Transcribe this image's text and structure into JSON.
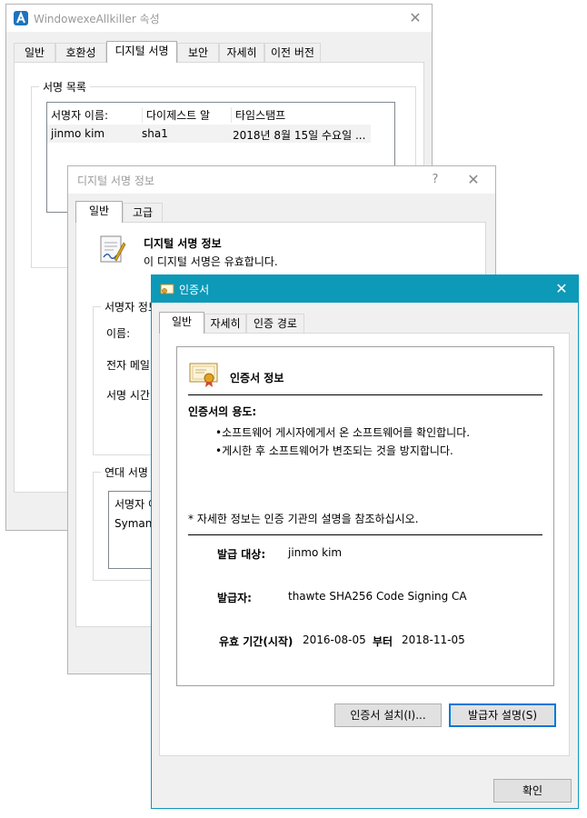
{
  "props_window": {
    "title": "WindowexeAllkiller 속성",
    "close": "✕",
    "tabs": [
      "일반",
      "호환성",
      "디지털 서명",
      "보안",
      "자세히",
      "이전 버전"
    ],
    "sig_list_group": "서명 목록",
    "columns": [
      "서명자 이름:",
      "다이제스트 알",
      "타임스탬프"
    ],
    "row": [
      "jinmo kim",
      "sha1",
      "2018년 8월 15일 수요일 ..."
    ]
  },
  "sig_details_window": {
    "title": "디지털 서명 정보",
    "help": "?",
    "close": "✕",
    "tabs": [
      "일반",
      "고급"
    ],
    "heading": "디지털 서명 정보",
    "status": "이 디지털 서명은 유효합니다.",
    "signer_group": "서명자 정보",
    "name_label": "이름:",
    "email_label": "전자 메일:",
    "time_label": "서명 시간:",
    "countersig_group": "연대 서명",
    "countersig_col": "서명자 이름:",
    "countersig_row": "Symantec"
  },
  "cert_window": {
    "title": "인증서",
    "close": "✕",
    "tabs": [
      "일반",
      "자세히",
      "인증 경로"
    ],
    "heading": "인증서 정보",
    "purpose_title": "인증서의 용도:",
    "purposes": [
      "•소프트웨어 게시자에게서 온 소프트웨어를 확인합니다.",
      "•게시한 후 소프트웨어가 변조되는 것을 방지합니다."
    ],
    "note": "* 자세한 정보는 인증 기관의 설명을 참조하십시오.",
    "issued_to_label": "발급 대상:",
    "issued_to": "jinmo kim",
    "issued_by_label": "발급자:",
    "issued_by": "thawte SHA256 Code Signing CA",
    "valid_label": "유효 기간(시작)",
    "valid_from": "2016-08-05",
    "valid_to_label": "부터",
    "valid_to": "2018-11-05",
    "install_button": "인증서 설치(I)...",
    "issuer_statement_button": "발급자 설명(S)",
    "ok_button": "확인",
    "accent": "#0d99b8"
  }
}
